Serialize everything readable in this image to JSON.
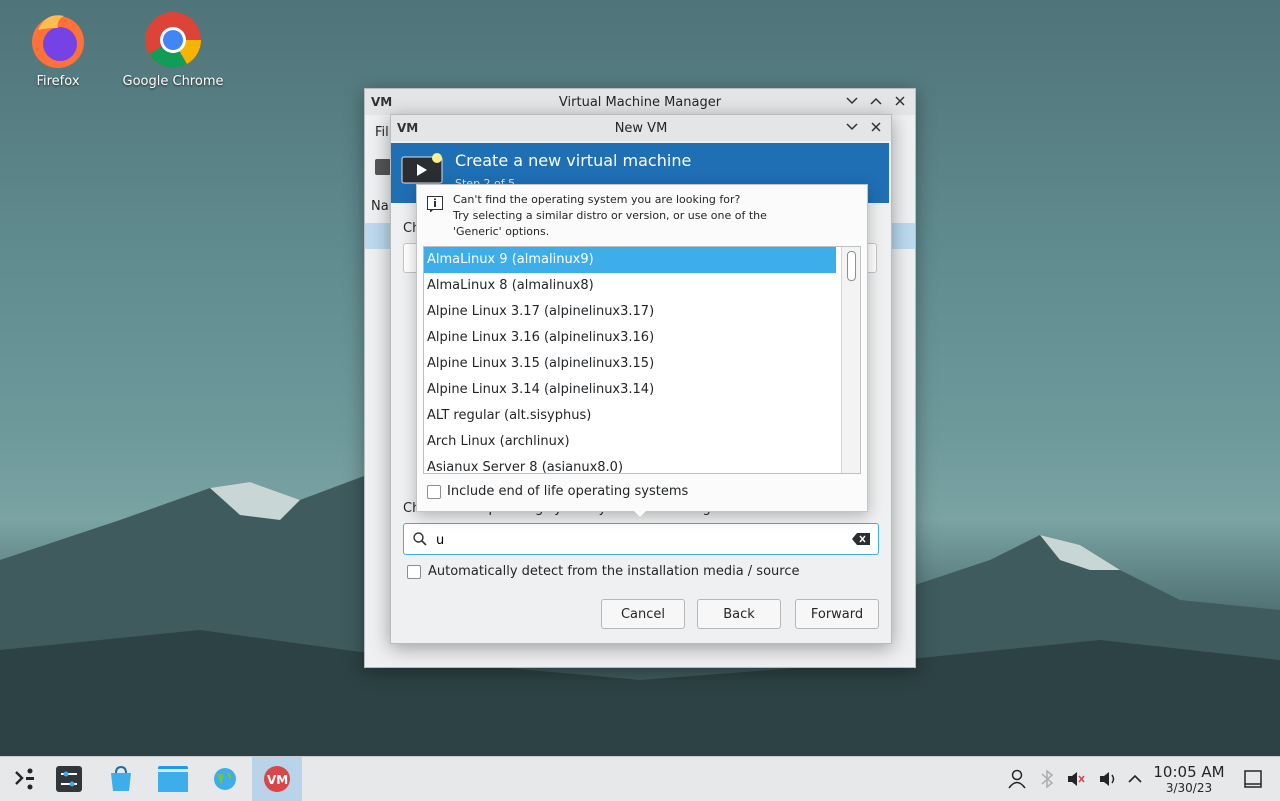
{
  "desktop": {
    "icons": [
      {
        "label": "Firefox",
        "icon": "firefox-icon"
      },
      {
        "label": "Google Chrome",
        "icon": "chrome-icon"
      }
    ]
  },
  "main_window": {
    "title": "Virtual Machine Manager",
    "menu_partial": "Fil",
    "column_partial": "Nam"
  },
  "new_vm": {
    "title": "New VM",
    "header_title": "Create a new virtual machine",
    "header_subtitle_partial": "Step 2 of 5",
    "choose_partial": "Ch",
    "os_label": "Choose the operating system you are installing:",
    "search": {
      "value": "u",
      "placeholder": ""
    },
    "auto_detect_label": "Automatically detect from the installation media / source",
    "auto_detect_checked": false,
    "buttons": {
      "cancel": "Cancel",
      "back": "Back",
      "forward": "Forward"
    }
  },
  "os_popup": {
    "hint_lines": [
      "Can't find the operating system you are looking for?",
      "Try selecting a similar distro or version, or use one of the",
      "'Generic' options."
    ],
    "items": [
      "AlmaLinux 9 (almalinux9)",
      "AlmaLinux 8 (almalinux8)",
      "Alpine Linux 3.17 (alpinelinux3.17)",
      "Alpine Linux 3.16 (alpinelinux3.16)",
      "Alpine Linux 3.15 (alpinelinux3.15)",
      "Alpine Linux 3.14 (alpinelinux3.14)",
      "ALT regular (alt.sisyphus)",
      "Arch Linux (archlinux)",
      "Asianux Server 8 (asianux8.0)"
    ],
    "selected_index": 0,
    "eol_label": "Include end of life operating systems",
    "eol_checked": false
  },
  "taskbar": {
    "time": "10:05 AM",
    "date": "3/30/23",
    "colors": {
      "accent": "#3daee9",
      "header": "#1f6fb4"
    }
  }
}
